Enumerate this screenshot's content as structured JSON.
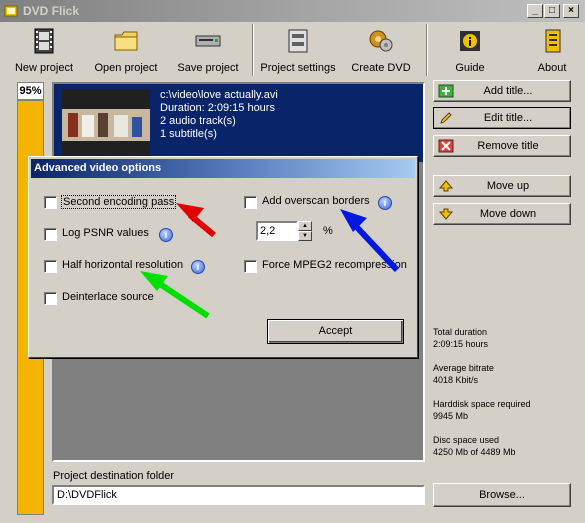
{
  "window": {
    "title": "DVD Flick"
  },
  "caption_buttons": {
    "minimize": "_",
    "maximize": "□",
    "close": "×"
  },
  "toolbar": [
    {
      "label": "New project",
      "icon": "film-icon"
    },
    {
      "label": "Open project",
      "icon": "folder-icon"
    },
    {
      "label": "Save project",
      "icon": "save-drive-icon"
    },
    {
      "label": "Project settings",
      "icon": "settings-icon"
    },
    {
      "label": "Create DVD",
      "icon": "create-dvd-icon"
    },
    {
      "label": "Guide",
      "icon": "guide-icon"
    },
    {
      "label": "About",
      "icon": "about-icon"
    }
  ],
  "progress": {
    "percent_label": "95%",
    "value": 0.95
  },
  "title_item": {
    "path": "c:\\video\\love actually.avi",
    "duration": "Duration: 2:09:15 hours",
    "audio": "2 audio track(s)",
    "subtitles": "1 subtitle(s)"
  },
  "side_buttons": {
    "add_title": "Add title...",
    "edit_title": "Edit title...",
    "remove_title": "Remove title",
    "move_up": "Move up",
    "move_down": "Move down",
    "browse": "Browse..."
  },
  "stats": {
    "total_duration_label": "Total duration",
    "total_duration_value": "2:09:15 hours",
    "avg_bitrate_label": "Average bitrate",
    "avg_bitrate_value": "4018 Kbit/s",
    "hdd_label": "Harddisk space required",
    "hdd_value": "9945 Mb",
    "disc_label": "Disc space used",
    "disc_value": "4250 Mb of 4489 Mb"
  },
  "destination": {
    "label": "Project destination folder",
    "value": "D:\\DVDFlick"
  },
  "dialog": {
    "title": "Advanced video options",
    "second_pass": "Second encoding pass",
    "log_psnr": "Log PSNR values",
    "half_res": "Half horizontal resolution",
    "deinterlace": "Deinterlace source",
    "overscan": "Add overscan borders",
    "overscan_value": "2,2",
    "percent_sign": "%",
    "force_mpeg2": "Force MPEG2 recompression",
    "accept": "Accept",
    "info_glyph": "i"
  },
  "colors": {
    "selection": "#0a246a",
    "progress": "#f5b400",
    "arrow_red": "#e00000",
    "arrow_green": "#00e000",
    "arrow_blue": "#0018e0"
  }
}
